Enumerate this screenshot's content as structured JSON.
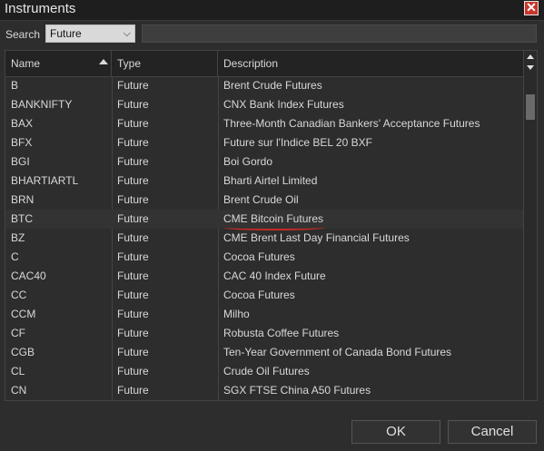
{
  "window": {
    "title": "Instruments",
    "close_symbol": "✕"
  },
  "search": {
    "label": "Search",
    "selected_type": "Future",
    "input_value": ""
  },
  "table": {
    "columns": {
      "name": "Name",
      "type": "Type",
      "description": "Description"
    },
    "sort": {
      "column": "Name",
      "direction": "ascending"
    },
    "rows": [
      {
        "name": "B",
        "type": "Future",
        "description": "Brent Crude Futures"
      },
      {
        "name": "BANKNIFTY",
        "type": "Future",
        "description": "CNX Bank Index Futures"
      },
      {
        "name": "BAX",
        "type": "Future",
        "description": "Three-Month Canadian Bankers' Acceptance Futures"
      },
      {
        "name": "BFX",
        "type": "Future",
        "description": "Future sur l'Indice BEL 20 BXF"
      },
      {
        "name": "BGI",
        "type": "Future",
        "description": "Boi Gordo"
      },
      {
        "name": "BHARTIARTL",
        "type": "Future",
        "description": "Bharti Airtel Limited"
      },
      {
        "name": "BRN",
        "type": "Future",
        "description": "Brent Crude Oil"
      },
      {
        "name": "BTC",
        "type": "Future",
        "description": "CME Bitcoin Futures"
      },
      {
        "name": "BZ",
        "type": "Future",
        "description": "CME Brent Last Day Financial Futures"
      },
      {
        "name": "C",
        "type": "Future",
        "description": "Cocoa Futures"
      },
      {
        "name": "CAC40",
        "type": "Future",
        "description": "CAC 40 Index Future"
      },
      {
        "name": "CC",
        "type": "Future",
        "description": "Cocoa Futures"
      },
      {
        "name": "CCM",
        "type": "Future",
        "description": "Milho"
      },
      {
        "name": "CF",
        "type": "Future",
        "description": "Robusta Coffee Futures"
      },
      {
        "name": "CGB",
        "type": "Future",
        "description": "Ten-Year Government of Canada Bond Futures"
      },
      {
        "name": "CL",
        "type": "Future",
        "description": "Crude Oil Futures"
      },
      {
        "name": "CN",
        "type": "Future",
        "description": "SGX FTSE China A50 Futures"
      }
    ],
    "highlighted_row": 7
  },
  "buttons": {
    "ok": "OK",
    "cancel": "Cancel"
  },
  "colors": {
    "background": "#2d2d2d",
    "annotation_underline": "#c42a25",
    "close_button": "#c8372d"
  }
}
